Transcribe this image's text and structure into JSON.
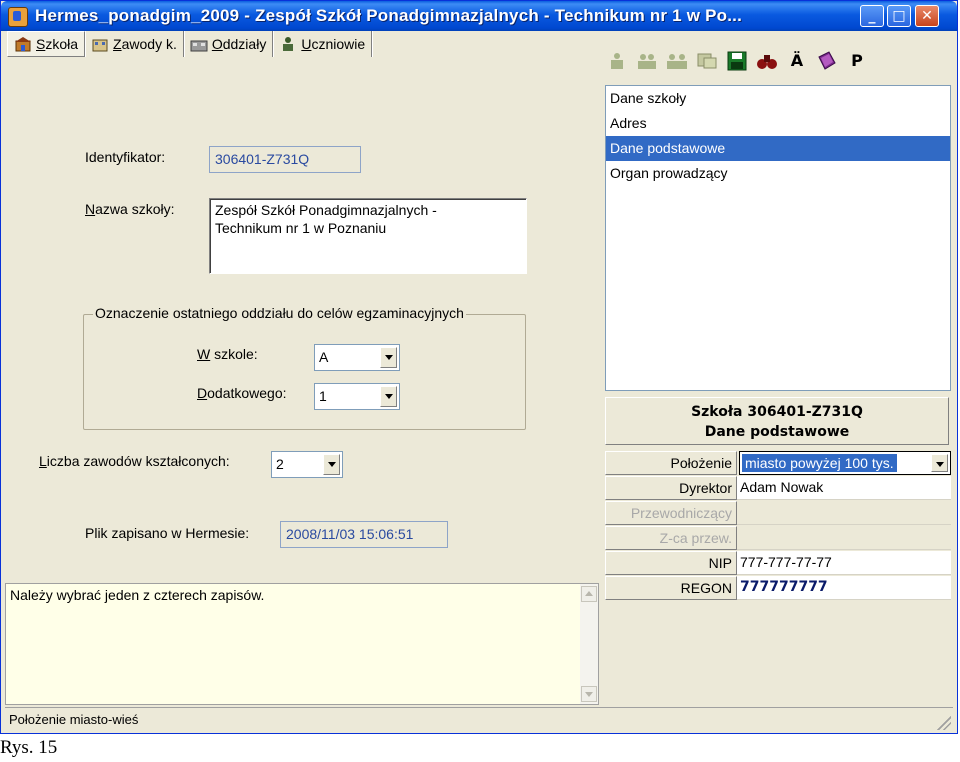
{
  "window": {
    "title": "Hermes_ponadgim_2009 - Zespół Szkół Ponadgimnazjalnych - Technikum nr 1 w Po...",
    "buttons": {
      "minimize": "_",
      "maximize": "□",
      "close": "✕"
    }
  },
  "tabs": [
    {
      "key": "S",
      "rest": "zkoła",
      "icon": "school-icon"
    },
    {
      "key": "Z",
      "rest": "awody k.",
      "icon": "professions-icon"
    },
    {
      "key": "O",
      "rest": "ddziały",
      "icon": "classes-icon"
    },
    {
      "key": "U",
      "rest": "czniowie",
      "icon": "students-icon"
    }
  ],
  "form": {
    "identifier_label": "Identyfikator:",
    "identifier_value": "306401-Z731Q",
    "school_name_label_key": "N",
    "school_name_label_rest": "azwa szkoły:",
    "school_name_line1": "Zespół Szkół Ponadgimnazjalnych -",
    "school_name_line2": "Technikum nr 1 w Poznaniu",
    "group_title": "Oznaczenie ostatniego oddziału do celów egzaminacyjnych",
    "in_school_label_key": "W",
    "in_school_label_rest": " szkole:",
    "in_school_value": "A",
    "additional_label_key": "D",
    "additional_label_rest": "odatkowego:",
    "additional_value": "1",
    "professions_count_label_key": "L",
    "professions_count_label_rest": "iczba zawodów kształconych:",
    "professions_count_value": "2",
    "saved_label": "Plik zapisano w Hermesie:",
    "saved_value": "2008/11/03 15:06:51"
  },
  "toolbar": {
    "icons": [
      "tool-1-icon",
      "tool-2-icon",
      "tool-3-icon",
      "tool-4-icon",
      "save-icon",
      "binoculars-icon",
      "umlaut-a-icon",
      "book-icon",
      "p-icon"
    ],
    "umlaut_label": "Ä",
    "p_label": "P"
  },
  "list": {
    "items": [
      "Dane szkoły",
      "Adres",
      "Dane podstawowe",
      "Organ prowadzący"
    ],
    "selected_index": 2
  },
  "details": {
    "header_line1": "Szkoła 306401-Z731Q",
    "header_line2": "Dane podstawowe",
    "rows": [
      {
        "name": "Położenie",
        "value": "miasto powyżej 100 tys.",
        "enabled": true
      },
      {
        "name": "Dyrektor",
        "value": "Adam Nowak",
        "enabled": true
      },
      {
        "name": "Przewodniczący",
        "value": "",
        "enabled": false
      },
      {
        "name": "Z-ca przew.",
        "value": "",
        "enabled": false
      },
      {
        "name": "NIP",
        "value": "777-777-77-77",
        "enabled": true
      },
      {
        "name": "REGON",
        "value": "777777777",
        "enabled": true
      }
    ]
  },
  "message": "Należy wybrać jeden z czterech zapisów.",
  "status": "Położenie miasto-wieś",
  "caption": "Rys. 15",
  "colors": {
    "titlebar": "#0a5ae0",
    "selection": "#316ac5",
    "message_bg": "#ffffe8",
    "face": "#ece9d8"
  }
}
